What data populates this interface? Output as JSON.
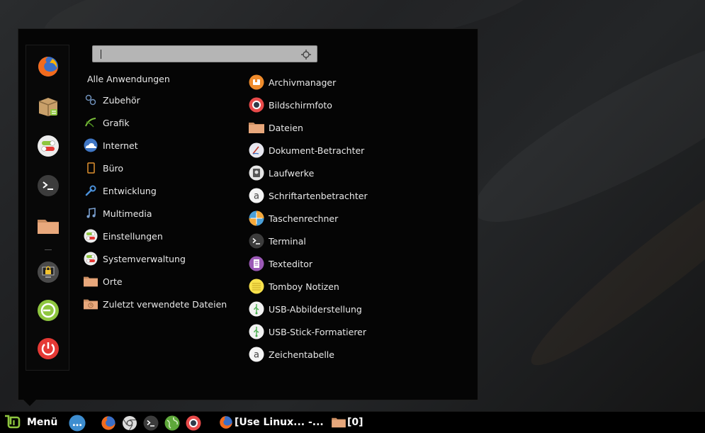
{
  "search": {
    "value": "",
    "placeholder": ""
  },
  "categories_header": "Alle Anwendungen",
  "categories": [
    {
      "label": "Zubehör",
      "icon": "gears-icon"
    },
    {
      "label": "Grafik",
      "icon": "pen-icon"
    },
    {
      "label": "Internet",
      "icon": "globe-cloud-icon"
    },
    {
      "label": "Büro",
      "icon": "document-icon"
    },
    {
      "label": "Entwicklung",
      "icon": "wrench-icon"
    },
    {
      "label": "Multimedia",
      "icon": "music-note-icon"
    },
    {
      "label": "Einstellungen",
      "icon": "toggle-settings-icon"
    },
    {
      "label": "Systemverwaltung",
      "icon": "toggle-settings-icon"
    },
    {
      "label": "Orte",
      "icon": "folder-icon"
    },
    {
      "label": "Zuletzt verwendete  Dateien",
      "icon": "recent-folder-icon"
    }
  ],
  "applications": [
    {
      "label": "Archivmanager",
      "icon": "archive-icon"
    },
    {
      "label": "Bildschirmfoto",
      "icon": "camera-icon"
    },
    {
      "label": "Dateien",
      "icon": "folder-icon"
    },
    {
      "label": "Dokument-Betrachter",
      "icon": "document-viewer-icon"
    },
    {
      "label": "Laufwerke",
      "icon": "disk-icon"
    },
    {
      "label": "Schriftartenbetrachter",
      "icon": "font-icon"
    },
    {
      "label": "Taschenrechner",
      "icon": "calculator-icon"
    },
    {
      "label": "Terminal",
      "icon": "terminal-icon"
    },
    {
      "label": "Texteditor",
      "icon": "text-editor-icon"
    },
    {
      "label": "Tomboy Notizen",
      "icon": "notes-icon"
    },
    {
      "label": "USB-Abbilderstellung",
      "icon": "usb-icon"
    },
    {
      "label": "USB-Stick-Formatierer",
      "icon": "usb-icon"
    },
    {
      "label": "Zeichentabelle",
      "icon": "font-icon"
    }
  ],
  "favorites": [
    "firefox-icon",
    "software-package-icon",
    "settings-toggle-icon",
    "terminal-icon",
    "folder-icon",
    "lock-screen-icon",
    "logout-icon",
    "power-icon"
  ],
  "taskbar": {
    "menu_label": "Menü",
    "windows": [
      {
        "label": "[Use Linux... -...",
        "icon": "firefox-icon"
      },
      {
        "label": "[0]",
        "icon": "folder-icon"
      }
    ]
  },
  "colors": {
    "accent_green": "#8ec63f",
    "power_red": "#e53935",
    "folder": "#e8a87c"
  }
}
